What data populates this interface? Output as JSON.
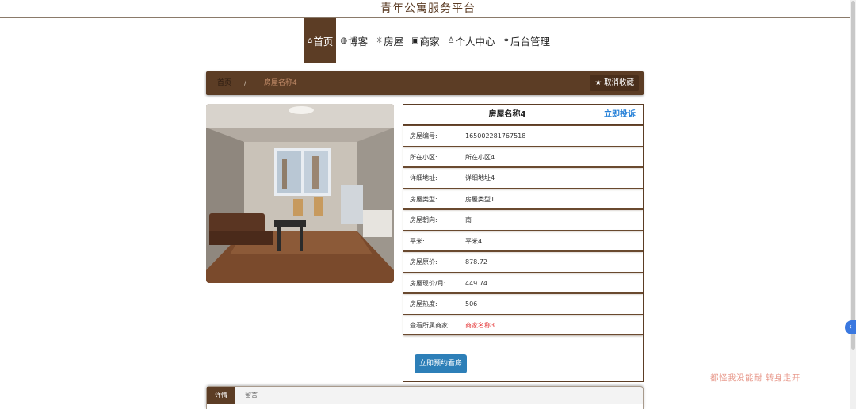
{
  "site_title": "青年公寓服务平台",
  "nav": [
    {
      "icon": "⌂",
      "icon_name": "home-icon",
      "label": "首页",
      "active": true
    },
    {
      "icon": "◍",
      "icon_name": "blog-icon",
      "label": "博客"
    },
    {
      "icon": "☼",
      "icon_name": "house-icon",
      "label": "房屋"
    },
    {
      "icon": "▣",
      "icon_name": "merchant-icon",
      "label": "商家"
    },
    {
      "icon": "♙",
      "icon_name": "user-icon",
      "label": "个人中心"
    },
    {
      "icon": "⚭",
      "icon_name": "link-icon",
      "label": "后台管理"
    }
  ],
  "breadcrumb": {
    "home": "首页",
    "separator": "/",
    "current": "房屋名称4"
  },
  "unfavorite_button": "★ 取消收藏",
  "detail": {
    "name": "房屋名称4",
    "complain": "立即投诉",
    "rows": [
      {
        "label": "房屋编号:",
        "value": "1650022817675​18"
      },
      {
        "label": "所在小区:",
        "value": "所在小区4"
      },
      {
        "label": "详细地址:",
        "value": "详细地址4"
      },
      {
        "label": "房屋类型:",
        "value": "房屋类型1"
      },
      {
        "label": "房屋朝向:",
        "value": "南"
      },
      {
        "label": "平米:",
        "value": "平米4"
      },
      {
        "label": "房屋原价:",
        "value": "878.72"
      },
      {
        "label": "房屋现价/月:",
        "value": "449.74"
      },
      {
        "label": "房屋热度:",
        "value": "506"
      },
      {
        "label": "查看所属商家:",
        "value": "商家名称3",
        "link": true
      }
    ],
    "book_button": "立即预约看房"
  },
  "tabs": {
    "details": "详情",
    "messages": "留言"
  },
  "watermark": "都怪我没能耐 转身走开",
  "colors": {
    "brand_brown": "#5c3d25",
    "link_blue": "#2580d8",
    "alert_red": "#e53b3b",
    "button_blue": "#2d7fb8"
  }
}
